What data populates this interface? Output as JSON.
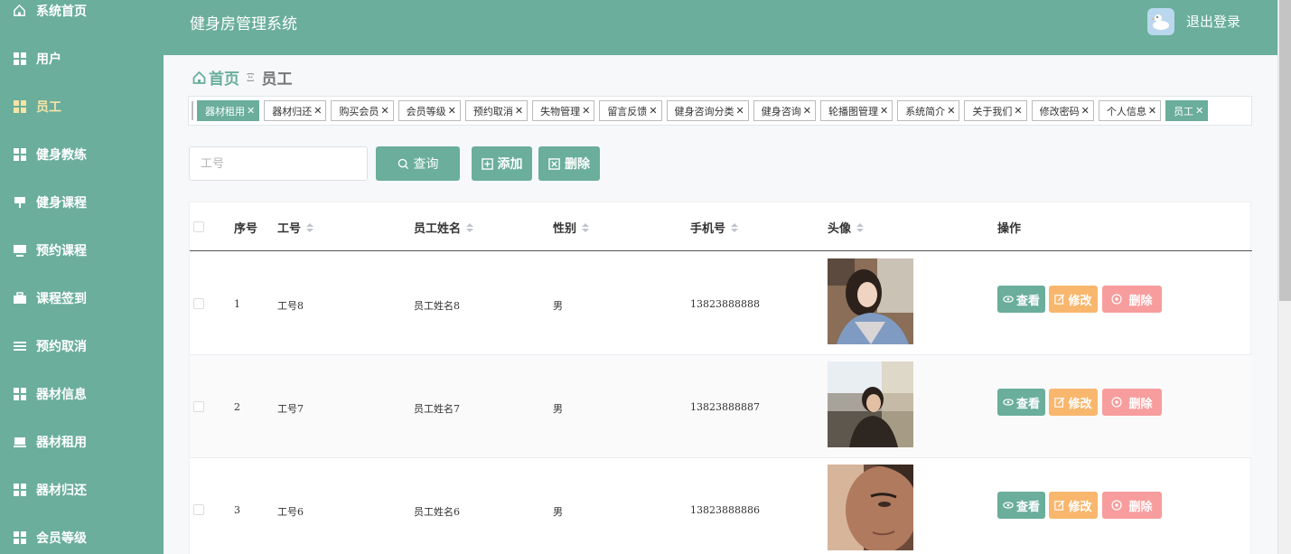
{
  "colors": {
    "primary": "#6aae9b",
    "edit": "#f8b76d",
    "delete": "#f79d9d",
    "active_menu": "#f7e4a7"
  },
  "sidebar": {
    "items": [
      {
        "label": "系统首页",
        "icon": "home-icon"
      },
      {
        "label": "用户",
        "icon": "grid-icon"
      },
      {
        "label": "员工",
        "icon": "grid-icon",
        "active": true
      },
      {
        "label": "健身教练",
        "icon": "grid-icon"
      },
      {
        "label": "健身课程",
        "icon": "presentation-icon"
      },
      {
        "label": "预约课程",
        "icon": "monitor-icon"
      },
      {
        "label": "课程签到",
        "icon": "briefcase-icon"
      },
      {
        "label": "预约取消",
        "icon": "list-icon"
      },
      {
        "label": "器材信息",
        "icon": "grid-icon"
      },
      {
        "label": "器材租用",
        "icon": "laptop-icon"
      },
      {
        "label": "器材归还",
        "icon": "grid-icon"
      },
      {
        "label": "会员等级",
        "icon": "grid-icon"
      }
    ]
  },
  "header": {
    "title": "健身房管理系统",
    "logout": "退出登录",
    "avatar_icon": "duck-icon"
  },
  "breadcrumb": {
    "home": "首页",
    "separator": "Ξ",
    "current": "员工"
  },
  "tags": [
    {
      "label": "器材租用",
      "active": true
    },
    {
      "label": "器材归还"
    },
    {
      "label": "购买会员"
    },
    {
      "label": "会员等级"
    },
    {
      "label": "预约取消"
    },
    {
      "label": "失物管理"
    },
    {
      "label": "留言反馈"
    },
    {
      "label": "健身咨询分类"
    },
    {
      "label": "健身咨询"
    },
    {
      "label": "轮播图管理"
    },
    {
      "label": "系统简介"
    },
    {
      "label": "关于我们"
    },
    {
      "label": "修改密码"
    },
    {
      "label": "个人信息"
    },
    {
      "label": "员工",
      "active": true
    }
  ],
  "tag_close": "✕",
  "search": {
    "placeholder": "工号",
    "value": "",
    "query_label": "查询",
    "add_label": "添加",
    "delete_label": "删除"
  },
  "table": {
    "headers": {
      "index": "序号",
      "job_no": "工号",
      "name": "员工姓名",
      "gender": "性别",
      "phone": "手机号",
      "avatar": "头像",
      "actions": "操作"
    },
    "rows": [
      {
        "index": "1",
        "job_no": "工号8",
        "name": "员工姓名8",
        "gender": "男",
        "phone": "13823888888",
        "photo": "photo-girl-in-cafe"
      },
      {
        "index": "2",
        "job_no": "工号7",
        "name": "员工姓名7",
        "gender": "男",
        "phone": "13823888887",
        "photo": "photo-boy-on-rooftop"
      },
      {
        "index": "3",
        "job_no": "工号6",
        "name": "员工姓名6",
        "gender": "男",
        "phone": "13823888886",
        "photo": "photo-man-closeup"
      }
    ],
    "actions": {
      "view": "查看",
      "edit": "修改",
      "delete": "删除"
    }
  }
}
